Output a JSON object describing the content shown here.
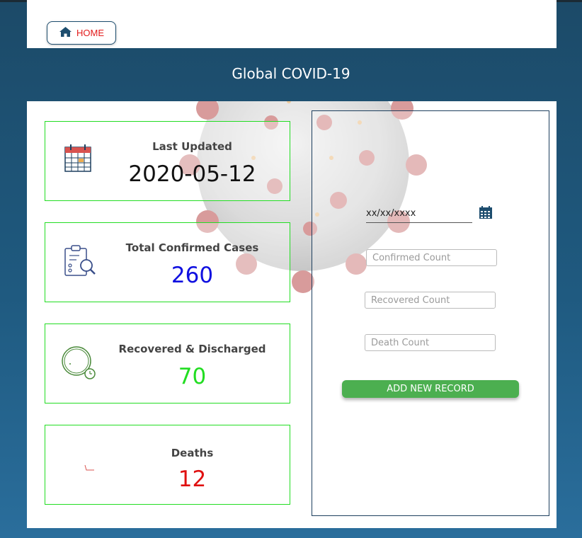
{
  "header": {
    "home_label": "HOME"
  },
  "page": {
    "title": "Global COVID-19"
  },
  "stats": {
    "last_updated": {
      "label": "Last Updated",
      "value": "2020-05-12",
      "color": "#111111"
    },
    "confirmed": {
      "label": "Total Confirmed Cases",
      "value": "260",
      "color": "#1010e0"
    },
    "recovered": {
      "label": "Recovered & Discharged",
      "value": "70",
      "color": "#22dd22"
    },
    "deaths": {
      "label": "Deaths",
      "value": "12",
      "color": "#e01010"
    }
  },
  "form": {
    "date_value": "xx/xx/xxxx",
    "confirmed_placeholder": "Confirmed Count",
    "recovered_placeholder": "Recovered Count",
    "death_placeholder": "Death Count",
    "submit_label": "ADD NEW RECORD"
  },
  "icons": {
    "home": "home-icon",
    "calendar": "calendar-icon",
    "clipboard": "clipboard-search-icon",
    "clock": "clock-icon",
    "deaths": "deaths-icon",
    "date_picker": "calendar-picker-icon"
  },
  "colors": {
    "accent": "#1d4d6e",
    "green": "#22dd22",
    "button": "#4caf50"
  }
}
